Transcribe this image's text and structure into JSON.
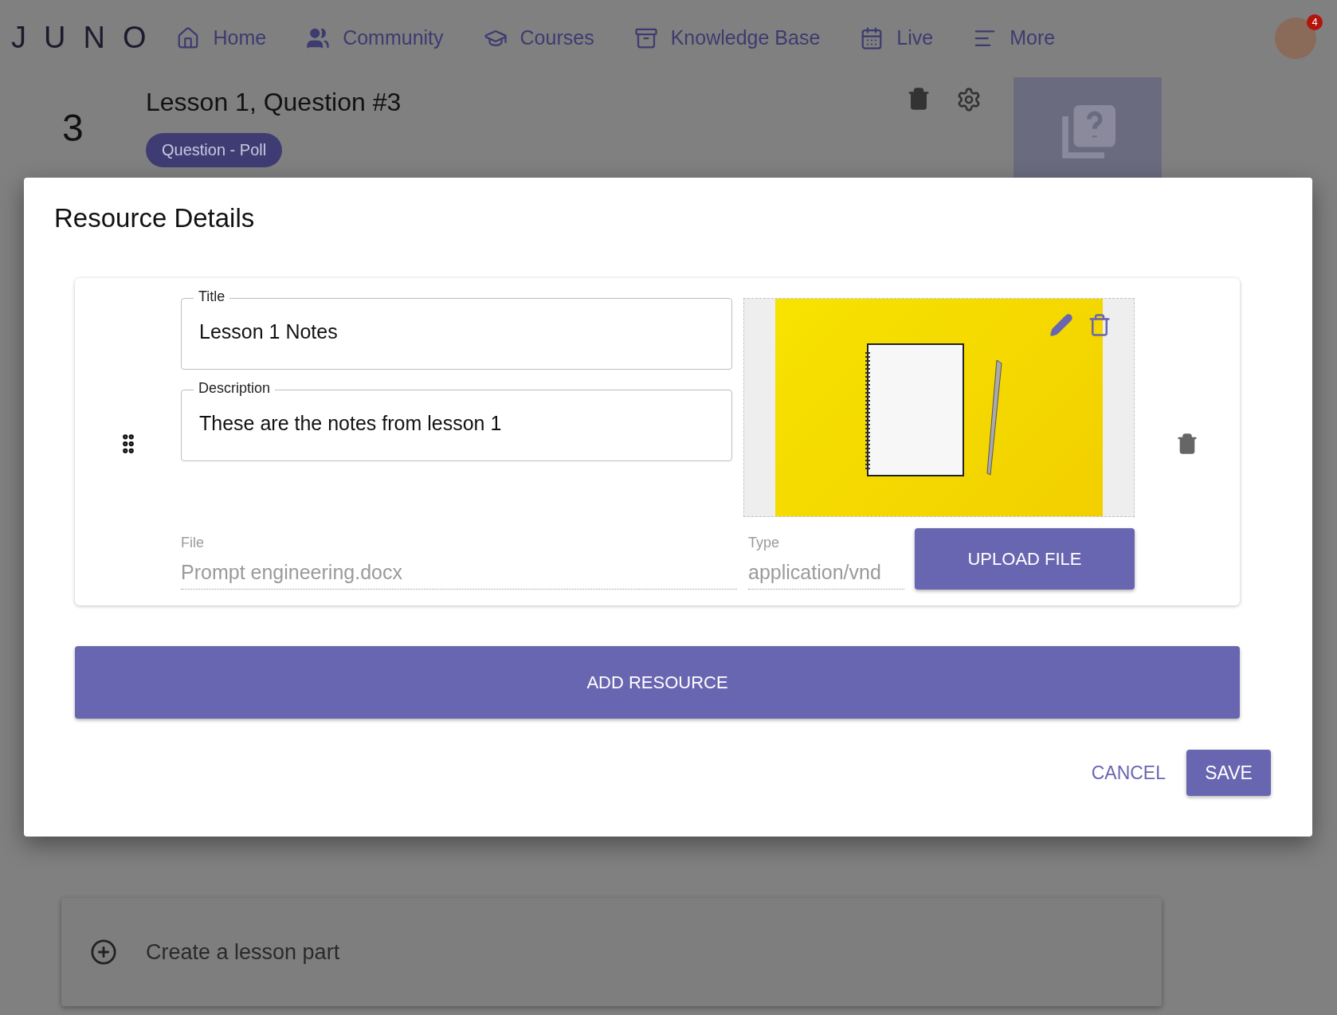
{
  "nav": {
    "logo": "JUNO",
    "items": [
      {
        "label": "Home",
        "kind": "home"
      },
      {
        "label": "Community",
        "kind": "people"
      },
      {
        "label": "Courses",
        "kind": "cap"
      },
      {
        "label": "Knowledge Base",
        "kind": "stand"
      },
      {
        "label": "Live",
        "kind": "calendar"
      },
      {
        "label": "More",
        "kind": "menu"
      }
    ],
    "avatar": {
      "badge": "4"
    }
  },
  "lesson": {
    "number": "3",
    "title": "Lesson 1, Question #3",
    "chip": "Question - Poll"
  },
  "create_part": {
    "label": "Create a lesson part"
  },
  "dialog": {
    "title": "Resource Details",
    "resources": [
      {
        "title_label": "Title",
        "title": "Lesson 1 Notes",
        "description_label": "Description",
        "description": "These are the notes from lesson 1",
        "file_label": "File",
        "file": "Prompt engineering.docx",
        "type_label": "Type",
        "type": "application/vnd",
        "upload": "UPLOAD FILE"
      }
    ],
    "add": "ADD RESOURCE",
    "cancel": "CANCEL",
    "save": "SAVE"
  }
}
